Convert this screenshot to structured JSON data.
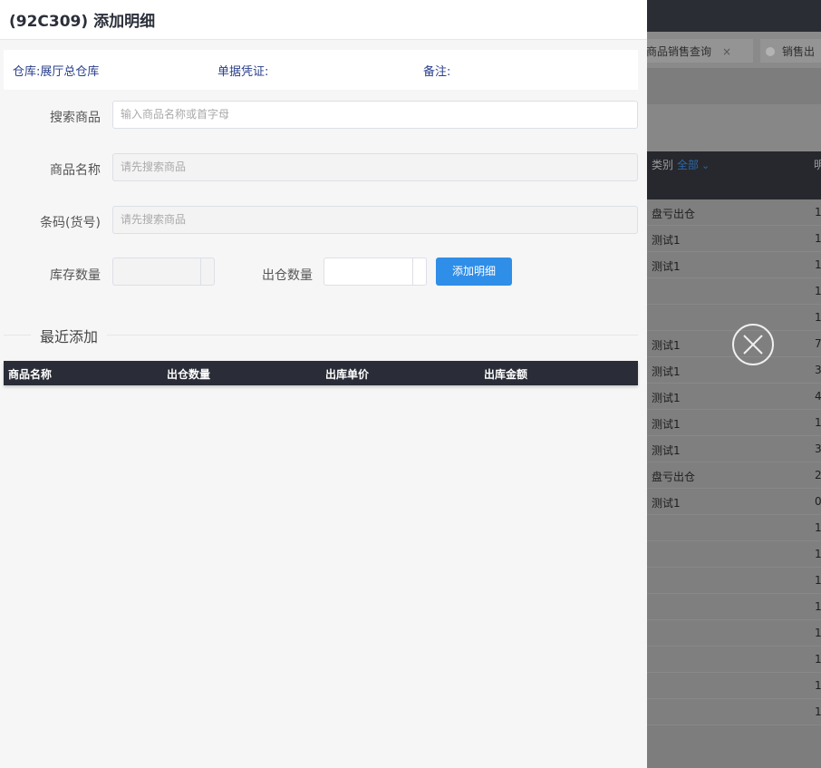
{
  "background": {
    "tabs": [
      {
        "label": "商品销售查询",
        "close": "×"
      },
      {
        "label": "销售出"
      }
    ],
    "table": {
      "category_label": "类别",
      "category_value": "全部",
      "second_col_header": "明",
      "rows": [
        {
          "c1": "盘亏出仓",
          "c2": "1"
        },
        {
          "c1": "测试1",
          "c2": "1"
        },
        {
          "c1": "测试1",
          "c2": "1"
        },
        {
          "c1": "",
          "c2": "1"
        },
        {
          "c1": "",
          "c2": "1"
        },
        {
          "c1": "测试1",
          "c2": "7"
        },
        {
          "c1": "测试1",
          "c2": "3"
        },
        {
          "c1": "测试1",
          "c2": "4"
        },
        {
          "c1": "测试1",
          "c2": "1"
        },
        {
          "c1": "测试1",
          "c2": "3"
        },
        {
          "c1": "盘亏出仓",
          "c2": "2"
        },
        {
          "c1": "测试1",
          "c2": "0"
        },
        {
          "c1": "",
          "c2": "1"
        },
        {
          "c1": "",
          "c2": "1"
        },
        {
          "c1": "",
          "c2": "1"
        },
        {
          "c1": "",
          "c2": "1"
        },
        {
          "c1": "",
          "c2": "1"
        },
        {
          "c1": "",
          "c2": "1"
        },
        {
          "c1": "",
          "c2": "1"
        },
        {
          "c1": "",
          "c2": "1"
        }
      ]
    }
  },
  "drawer": {
    "title": "(92C309) 添加明细",
    "info": {
      "warehouse": "仓库:展厅总仓库",
      "voucher": "单据凭证:",
      "remark": "备注:"
    },
    "form": {
      "search_label": "搜索商品",
      "search_placeholder": "输入商品名称或首字母",
      "name_label": "商品名称",
      "name_placeholder": "请先搜索商品",
      "barcode_label": "条码(货号)",
      "barcode_placeholder": "请先搜索商品",
      "stock_label": "库存数量",
      "out_qty_label": "出仓数量",
      "add_button": "添加明细"
    },
    "recent": {
      "title": "最近添加",
      "columns": [
        "商品名称",
        "出仓数量",
        "出库单价",
        "出库金额"
      ]
    }
  }
}
